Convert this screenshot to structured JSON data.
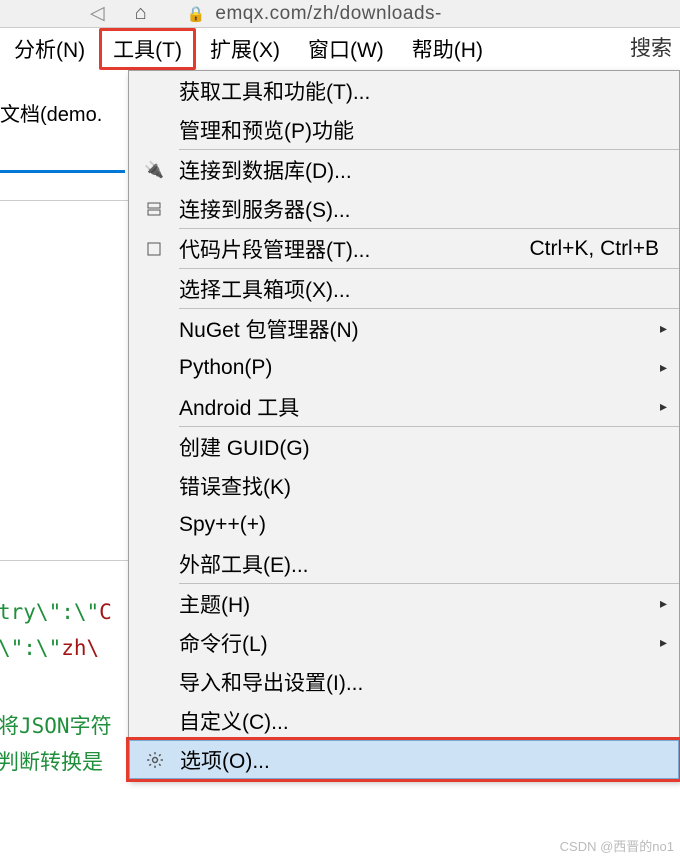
{
  "browser": {
    "url": "emqx.com/zh/downloads-"
  },
  "menubar": {
    "items": [
      {
        "label": "分析(N)"
      },
      {
        "label": "工具(T)",
        "active": true
      },
      {
        "label": "扩展(X)"
      },
      {
        "label": "窗口(W)"
      },
      {
        "label": "帮助(H)"
      }
    ],
    "search_placeholder": "搜索"
  },
  "doc": {
    "tab": "文档(demo."
  },
  "code": {
    "line1a": "try\\\":\\\"",
    "line1b": "C",
    "line2a": "\\\":\\\"",
    "line2b": "zh\\",
    "comment1": "将JSON字符",
    "comment2": "判断转换是"
  },
  "dropdown": {
    "items": [
      {
        "label": "获取工具和功能(T)...",
        "icon": ""
      },
      {
        "label": "管理和预览(P)功能",
        "icon": ""
      },
      {
        "sep": true
      },
      {
        "label": "连接到数据库(D)...",
        "icon": "db"
      },
      {
        "label": "连接到服务器(S)...",
        "icon": "server"
      },
      {
        "sep": true
      },
      {
        "label": "代码片段管理器(T)...",
        "icon": "snippet",
        "shortcut": "Ctrl+K, Ctrl+B"
      },
      {
        "sep": true
      },
      {
        "label": "选择工具箱项(X)...",
        "icon": ""
      },
      {
        "sep": true
      },
      {
        "label": "NuGet 包管理器(N)",
        "icon": "",
        "submenu": true
      },
      {
        "label": "Python(P)",
        "icon": "",
        "submenu": true
      },
      {
        "label": "Android 工具",
        "icon": "",
        "submenu": true
      },
      {
        "sep": true
      },
      {
        "label": "创建 GUID(G)",
        "icon": ""
      },
      {
        "label": "错误查找(K)",
        "icon": ""
      },
      {
        "label": "Spy++(+)",
        "icon": ""
      },
      {
        "label": "外部工具(E)...",
        "icon": ""
      },
      {
        "sep": true
      },
      {
        "label": "主题(H)",
        "icon": "",
        "submenu": true
      },
      {
        "label": "命令行(L)",
        "icon": "",
        "submenu": true
      },
      {
        "label": "导入和导出设置(I)...",
        "icon": ""
      },
      {
        "label": "自定义(C)...",
        "icon": ""
      },
      {
        "label": "选项(O)...",
        "icon": "gear",
        "highlighted": true
      }
    ]
  },
  "watermark": "CSDN @西晋的no1"
}
